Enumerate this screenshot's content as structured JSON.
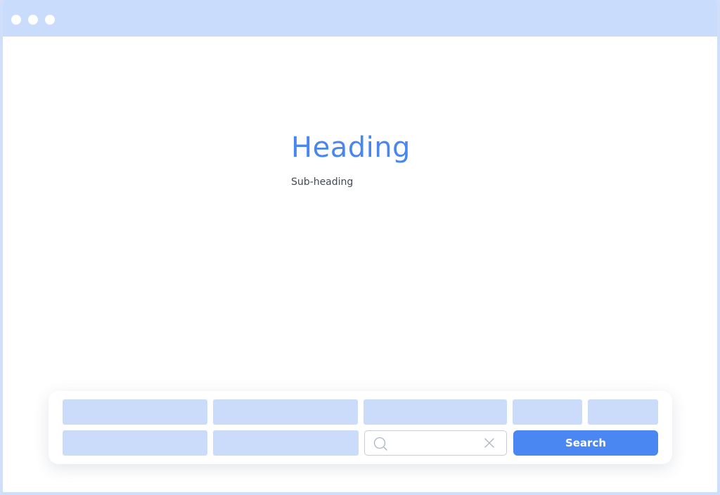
{
  "window": {
    "titlebar_color": "#cadcfc",
    "controls": [
      "window-dot",
      "window-dot",
      "window-dot"
    ]
  },
  "hero": {
    "heading": "Heading",
    "subheading": "Sub-heading",
    "heading_color": "#4a86f0"
  },
  "search": {
    "input_value": "",
    "input_placeholder": "",
    "search_icon": "search-icon",
    "clear_icon": "close-icon",
    "button_label": "Search",
    "button_color": "#4b87f2",
    "placeholder_color": "#cbdcfb"
  }
}
